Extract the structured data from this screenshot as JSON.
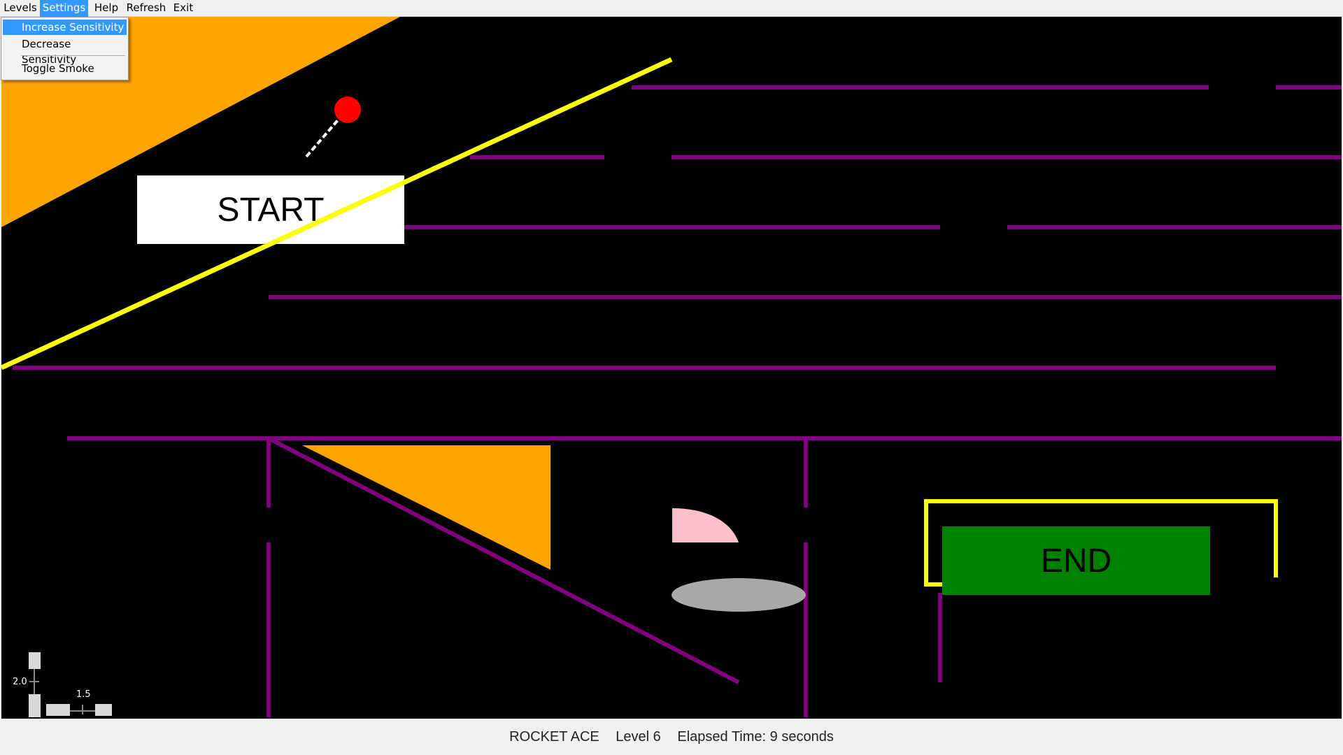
{
  "menu": {
    "items": [
      "Levels",
      "Settings",
      "Help",
      "Refresh",
      "Exit"
    ],
    "active": "Settings"
  },
  "settings_menu": {
    "items": [
      "Increase Sensitivity",
      "Decrease Sensitivity",
      "Toggle Smoke"
    ],
    "highlighted": "Increase Sensitivity"
  },
  "game": {
    "start_label": "START",
    "end_label": "END",
    "colors": {
      "background": "#000000",
      "wall": "#800080",
      "ramp": "#ffa500",
      "rocket": "#ff0000",
      "laser": "#ffff00",
      "start_box": "#ffffff",
      "end_box": "#008000",
      "pink_shape": "#ffc0cb",
      "gray_ellipse": "#a9a9a9"
    },
    "sensitivity": {
      "vertical": "2.0",
      "horizontal": "1.5"
    }
  },
  "status": {
    "app_name": "ROCKET ACE",
    "level": "Level 6",
    "elapsed": "Elapsed Time: 9 seconds"
  }
}
